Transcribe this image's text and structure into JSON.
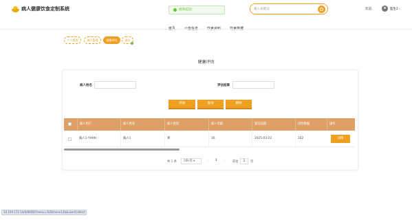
{
  "header": {
    "site_title": "病人健康饮食定制系统",
    "toast": "修改成功!",
    "search_placeholder": "输入关键词",
    "welcome": "欢迎,",
    "username": "医生2",
    "accent_color": "#f0a020"
  },
  "nav": [
    "首页",
    "公告信息",
    "饮食资料",
    "饮食数据"
  ],
  "breadcrumbs": [
    "个人首页",
    "病人管理",
    "健康评估",
    "退出"
  ],
  "page_title": "健康评估",
  "filters": {
    "patient_name_label": "病人姓名",
    "patient_name_value": "",
    "result_label": "评估结果",
    "result_value": ""
  },
  "actions": {
    "add": "添加",
    "search": "查询",
    "delete": "删除"
  },
  "table": {
    "headers": [
      "病人用户",
      "病人姓名",
      "病人性别",
      "病人年龄",
      "登记日期",
      "风险数据",
      "操作"
    ],
    "rows": [
      {
        "user": "病人1-YHHH",
        "name": "病人1",
        "gender": "男",
        "age": "30",
        "date": "2025-03-22",
        "risk": "102",
        "op": "详情"
      }
    ]
  },
  "pager": {
    "total": "共 1 条",
    "page_size": "5条/页",
    "current": "1",
    "goto": "前往",
    "jump": "1",
    "page_suffix": "页"
  },
  "statusbar": "10.100.172.14/0/8009/?menu=%5Bmenu12b&userl/collect"
}
